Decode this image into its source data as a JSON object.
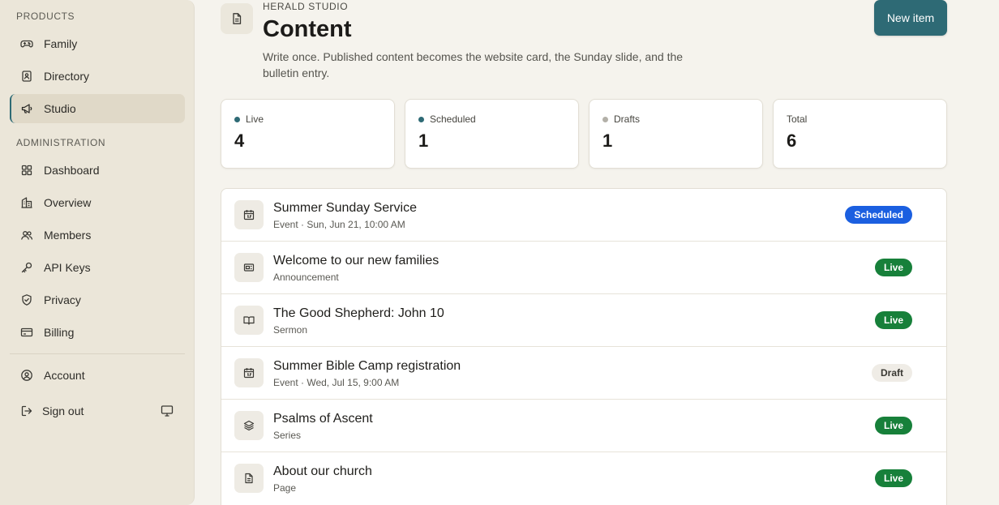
{
  "sidebar": {
    "products_label": "PRODUCTS",
    "admin_label": "ADMINISTRATION",
    "products": [
      {
        "label": "Family",
        "icon": "gamepad-icon"
      },
      {
        "label": "Directory",
        "icon": "contact-book-icon"
      },
      {
        "label": "Studio",
        "icon": "megaphone-icon",
        "active": true
      }
    ],
    "admin": [
      {
        "label": "Dashboard",
        "icon": "grid-icon"
      },
      {
        "label": "Overview",
        "icon": "building-icon"
      },
      {
        "label": "Members",
        "icon": "users-icon"
      },
      {
        "label": "API Keys",
        "icon": "key-icon"
      },
      {
        "label": "Privacy",
        "icon": "shield-icon"
      },
      {
        "label": "Billing",
        "icon": "credit-card-icon"
      }
    ],
    "account_label": "Account",
    "signout_label": "Sign out"
  },
  "header": {
    "eyebrow": "HERALD STUDIO",
    "title": "Content",
    "description": "Write once. Published content becomes the website card, the Sunday slide, and the bulletin entry.",
    "new_button": "New item"
  },
  "stats": [
    {
      "label": "Live",
      "value": "4",
      "dot": "#2e6a75"
    },
    {
      "label": "Scheduled",
      "value": "1",
      "dot": "#2e6a75"
    },
    {
      "label": "Drafts",
      "value": "1",
      "dot": "#b3b0a8"
    },
    {
      "label": "Total",
      "value": "6"
    }
  ],
  "items": [
    {
      "title": "Summer Sunday Service",
      "subtitle": "Event · Sun, Jun 21, 10:00 AM",
      "status": "Scheduled",
      "icon": "calendar-icon"
    },
    {
      "title": "Welcome to our new families",
      "subtitle": "Announcement",
      "status": "Live",
      "icon": "newspaper-icon"
    },
    {
      "title": "The Good Shepherd: John 10",
      "subtitle": "Sermon",
      "status": "Live",
      "icon": "book-icon"
    },
    {
      "title": "Summer Bible Camp registration",
      "subtitle": "Event · Wed, Jul 15, 9:00 AM",
      "status": "Draft",
      "icon": "calendar-icon"
    },
    {
      "title": "Psalms of Ascent",
      "subtitle": "Series",
      "status": "Live",
      "icon": "layers-icon"
    },
    {
      "title": "About our church",
      "subtitle": "Page",
      "status": "Live",
      "icon": "document-icon"
    }
  ],
  "colors": {
    "accent": "#2e6a75",
    "live": "#17803a",
    "scheduled": "#1b5fe0",
    "draft": "#efece6",
    "sidebar_bg": "#ebe6d9",
    "page_bg": "#f5f3ed"
  }
}
